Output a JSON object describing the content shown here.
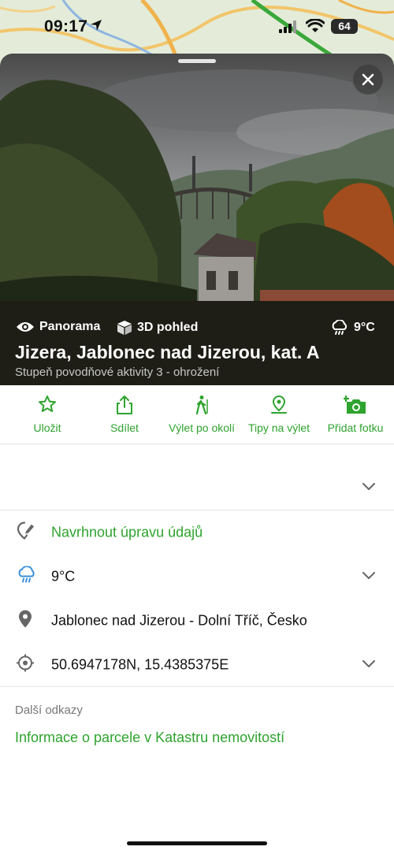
{
  "status_bar": {
    "time": "09:17",
    "battery": "64"
  },
  "photo": {
    "alt": "panorama"
  },
  "info": {
    "panorama_label": "Panorama",
    "view3d_label": "3D pohled",
    "temperature": "9°C",
    "title": "Jizera, Jablonec nad Jizerou, kat. A",
    "subtitle": "Stupeň povodňové aktivity 3 - ohrožení"
  },
  "actions": [
    {
      "label": "Uložit",
      "icon": "star-icon"
    },
    {
      "label": "Sdílet",
      "icon": "share-icon"
    },
    {
      "label": "Výlet po okolí",
      "icon": "hiker-icon"
    },
    {
      "label": "Tipy na výlet",
      "icon": "pin-icon"
    },
    {
      "label": "Přidat fotku",
      "icon": "add-photo-icon"
    }
  ],
  "details": {
    "suggest_edit": "Navrhnout úpravu údajů",
    "weather": "9°C",
    "address": "Jablonec nad Jizerou - Dolní Tříč, Česko",
    "coordinates": "50.6947178N, 15.4385375E"
  },
  "links": {
    "section_title": "Další odkazy",
    "cadastre": "Informace o parcele v Katastru nemovitostí"
  },
  "colors": {
    "accent": "#2ea32e",
    "strip": "#1e1e17"
  }
}
